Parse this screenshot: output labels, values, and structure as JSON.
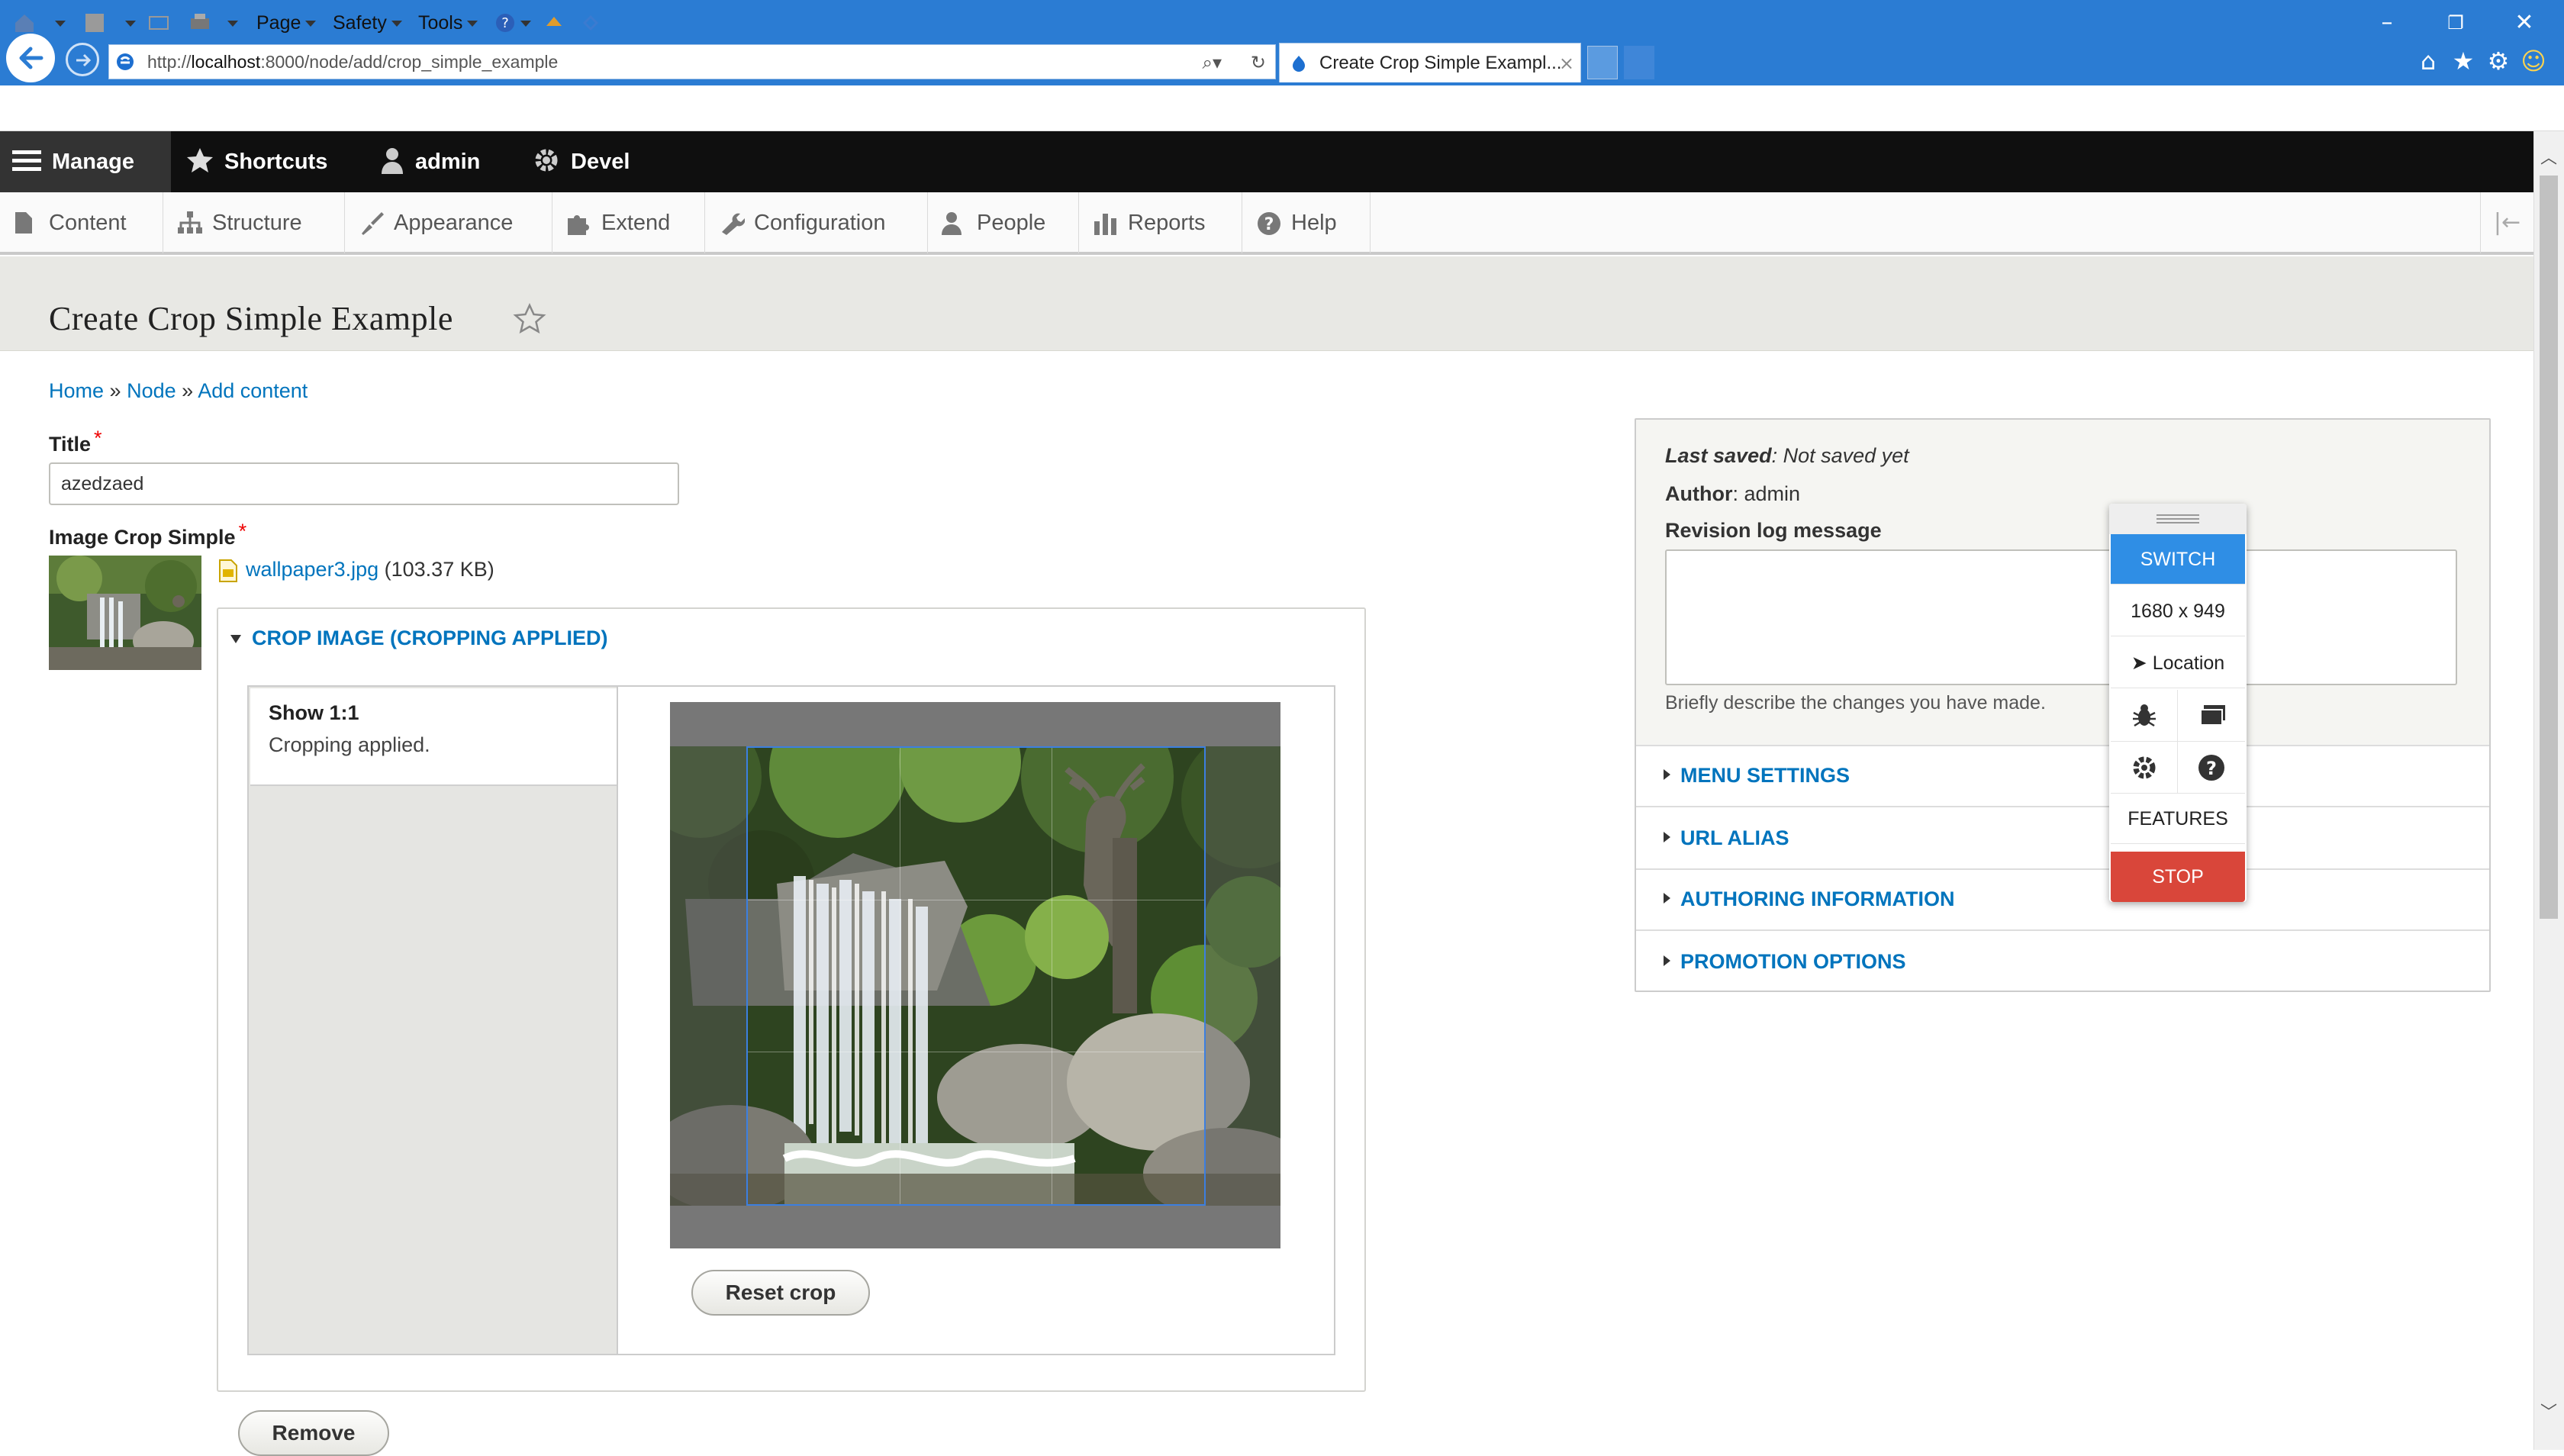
{
  "browser": {
    "url_prefix": "http://",
    "url_host": "localhost",
    "url_rest": ":8000/node/add/crop_simple_example",
    "tab_title": "Create Crop Simple Exampl...",
    "tab_close": "×",
    "window_controls": [
      "–",
      "❐",
      "✕"
    ],
    "command_bar": {
      "page": "Page",
      "safety": "Safety",
      "tools": "Tools"
    }
  },
  "toolbar": {
    "manage": "Manage",
    "shortcuts": "Shortcuts",
    "user": "admin",
    "devel": "Devel"
  },
  "tray": {
    "items": [
      "Content",
      "Structure",
      "Appearance",
      "Extend",
      "Configuration",
      "People",
      "Reports",
      "Help"
    ]
  },
  "page": {
    "title": "Create Crop Simple Example",
    "breadcrumb": [
      "Home",
      "Node",
      "Add content"
    ],
    "breadcrumb_sep": "»"
  },
  "form": {
    "title_label": "Title",
    "title_value": "azedzaed",
    "required_mark": "*",
    "image_label": "Image Crop Simple",
    "file_name": "wallpaper3.jpg",
    "file_size": "(103.37 KB)",
    "crop_summary": "CROP IMAGE (CROPPING APPLIED)",
    "vtab_title": "Show 1:1",
    "vtab_summary": "Cropping applied.",
    "reset_crop": "Reset crop",
    "remove": "Remove"
  },
  "sidebar": {
    "last_saved_label": "Last saved",
    "last_saved_value": ": Not saved yet",
    "author_label": "Author",
    "author_value": ": admin",
    "revision_label": "Revision log message",
    "revision_value": "",
    "revision_desc": "Briefly describe the changes you have made.",
    "sections": [
      "MENU SETTINGS",
      "URL ALIAS",
      "AUTHORING INFORMATION",
      "PROMOTION OPTIONS"
    ]
  },
  "widget": {
    "switch": "SWITCH",
    "resolution": "1680 x 949",
    "location": "Location",
    "features": "FEATURES",
    "stop": "STOP"
  },
  "colors": {
    "accent_link": "#0074bd",
    "ie_blue": "#2b7cd3",
    "toolbar_black": "#0f0f0f",
    "widget_switch": "#2f8ee5",
    "widget_stop": "#d9463a",
    "crop_selection": "#3c7fe0"
  }
}
